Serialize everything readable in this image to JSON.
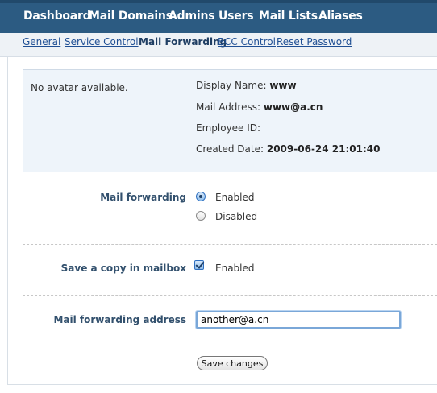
{
  "top_nav": {
    "items": [
      "Dashboard",
      "Mail Domains",
      "Admins",
      "Users",
      "Mail Lists",
      "Aliases"
    ]
  },
  "sub_nav": {
    "items": [
      "General",
      "Service Control",
      "Mail Forwarding",
      "BCC Control",
      "Reset Password"
    ],
    "active": "Mail Forwarding"
  },
  "profile": {
    "avatar_text": "No avatar available.",
    "display_name_label": "Display Name:",
    "display_name": "www",
    "mail_address_label": "Mail Address:",
    "mail_address": "www@a.cn",
    "employee_id_label": "Employee ID:",
    "employee_id": "",
    "created_date_label": "Created Date:",
    "created_date": "2009-06-24 21:01:40"
  },
  "form": {
    "mail_forwarding_label": "Mail forwarding",
    "option_enabled": "Enabled",
    "option_disabled": "Disabled",
    "mail_forwarding_selected": "Enabled",
    "save_copy_label": "Save a copy in mailbox",
    "save_copy_option": "Enabled",
    "save_copy_checked": true,
    "forwarding_address_label": "Mail forwarding address",
    "forwarding_address_value": "another@a.cn",
    "save_button": "Save changes"
  },
  "colors": {
    "nav_bar": "#2c5b82",
    "subnav_bg": "#eef2f6",
    "profile_bg": "#eef4fa",
    "link": "#1f4f94"
  }
}
